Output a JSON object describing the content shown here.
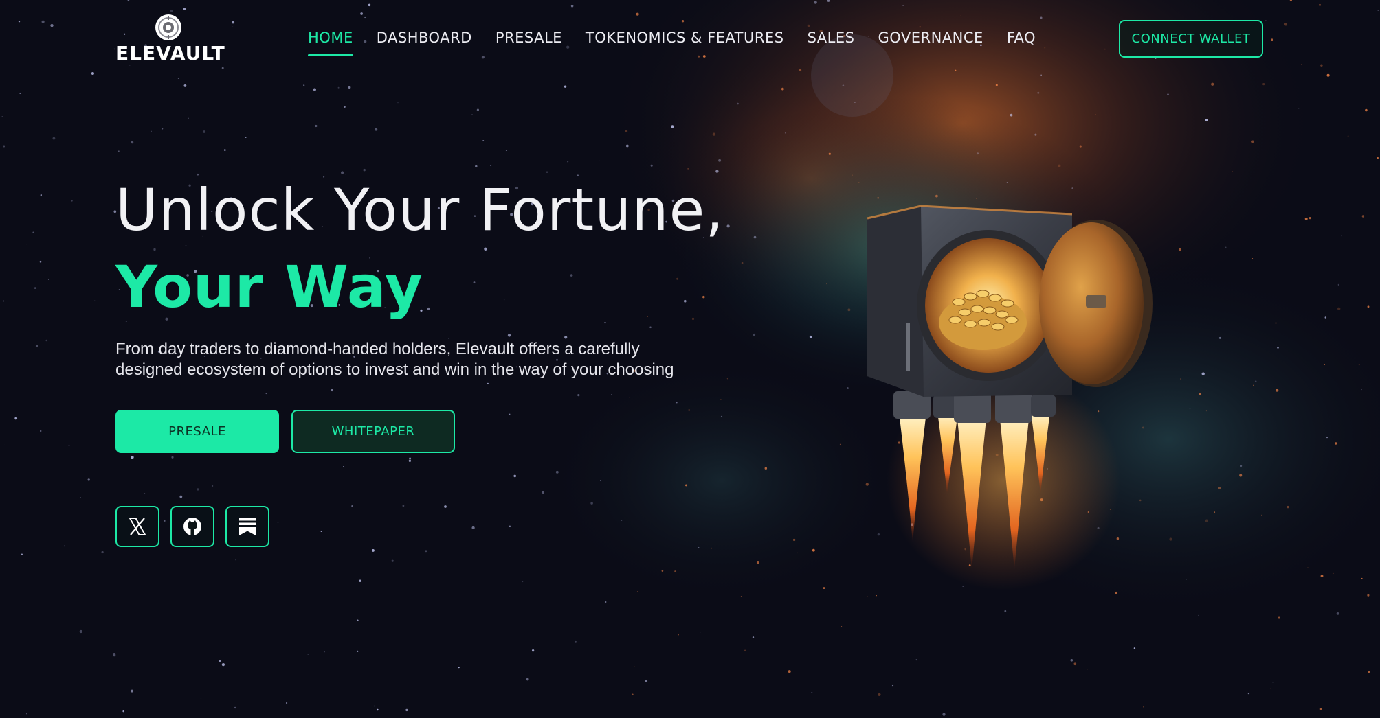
{
  "colors": {
    "accent": "#1de9a6",
    "background": "#0b0c17",
    "text": "#f1f1f4"
  },
  "logo": {
    "text": "ELEVAULT",
    "icon": "vault-dial-icon"
  },
  "nav": {
    "items": [
      {
        "label": "HOME",
        "active": true
      },
      {
        "label": "DASHBOARD",
        "active": false
      },
      {
        "label": "PRESALE",
        "active": false
      },
      {
        "label": "TOKENOMICS & FEATURES",
        "active": false
      },
      {
        "label": "SALES",
        "active": false
      },
      {
        "label": "GOVERNANCE",
        "active": false
      },
      {
        "label": "FAQ",
        "active": false
      }
    ]
  },
  "header": {
    "connect_wallet_label": "CONNECT WALLET"
  },
  "hero": {
    "title_line1": "Unlock Your Fortune,",
    "title_line2": "Your Way",
    "description_line1": "From day traders to diamond-handed holders, Elevault offers a carefully",
    "description_line2": "designed ecosystem of options to invest and win in the way of your choosing",
    "presale_label": "PRESALE",
    "whitepaper_label": "WHITEPAPER",
    "illustration": "rocket-powered vault full of gold coins in space"
  },
  "social": [
    {
      "icon": "x-icon"
    },
    {
      "icon": "github-icon"
    },
    {
      "icon": "substack-icon"
    }
  ]
}
